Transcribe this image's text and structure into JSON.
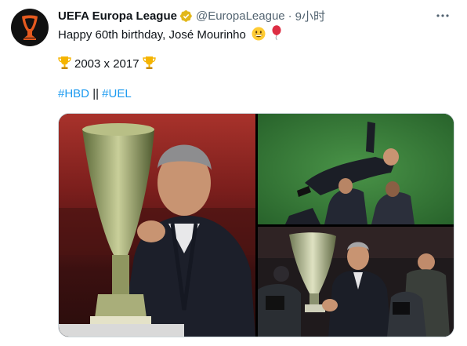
{
  "account": {
    "name": "UEFA Europa League",
    "handle": "@EuropaLeague",
    "separator": "·",
    "time": "9小时"
  },
  "tweet": {
    "line1": "Happy 60th birthday, José Mourinho",
    "line2": "2003 x 2017",
    "hashtag1": "#HBD",
    "hashtag_sep": "||",
    "hashtag2": "#UEL"
  },
  "icons": {
    "avatar": "uefa-europa-league-logo",
    "verified": "gold-verified-badge",
    "more": "more-dots-icon",
    "emoji1": "grinning-face-emoji",
    "emoji2": "balloon-emoji",
    "trophy": "trophy-emoji"
  },
  "media": {
    "count": 3,
    "photos": [
      "jose-mourinho-with-trophy",
      "mourinho-tossed-in-air-celebration",
      "mourinho-lifting-trophy-crowd"
    ]
  },
  "colors": {
    "hashtag": "#1d9bf0",
    "secondary_text": "#536471",
    "verified_gold": "#e2b719"
  }
}
